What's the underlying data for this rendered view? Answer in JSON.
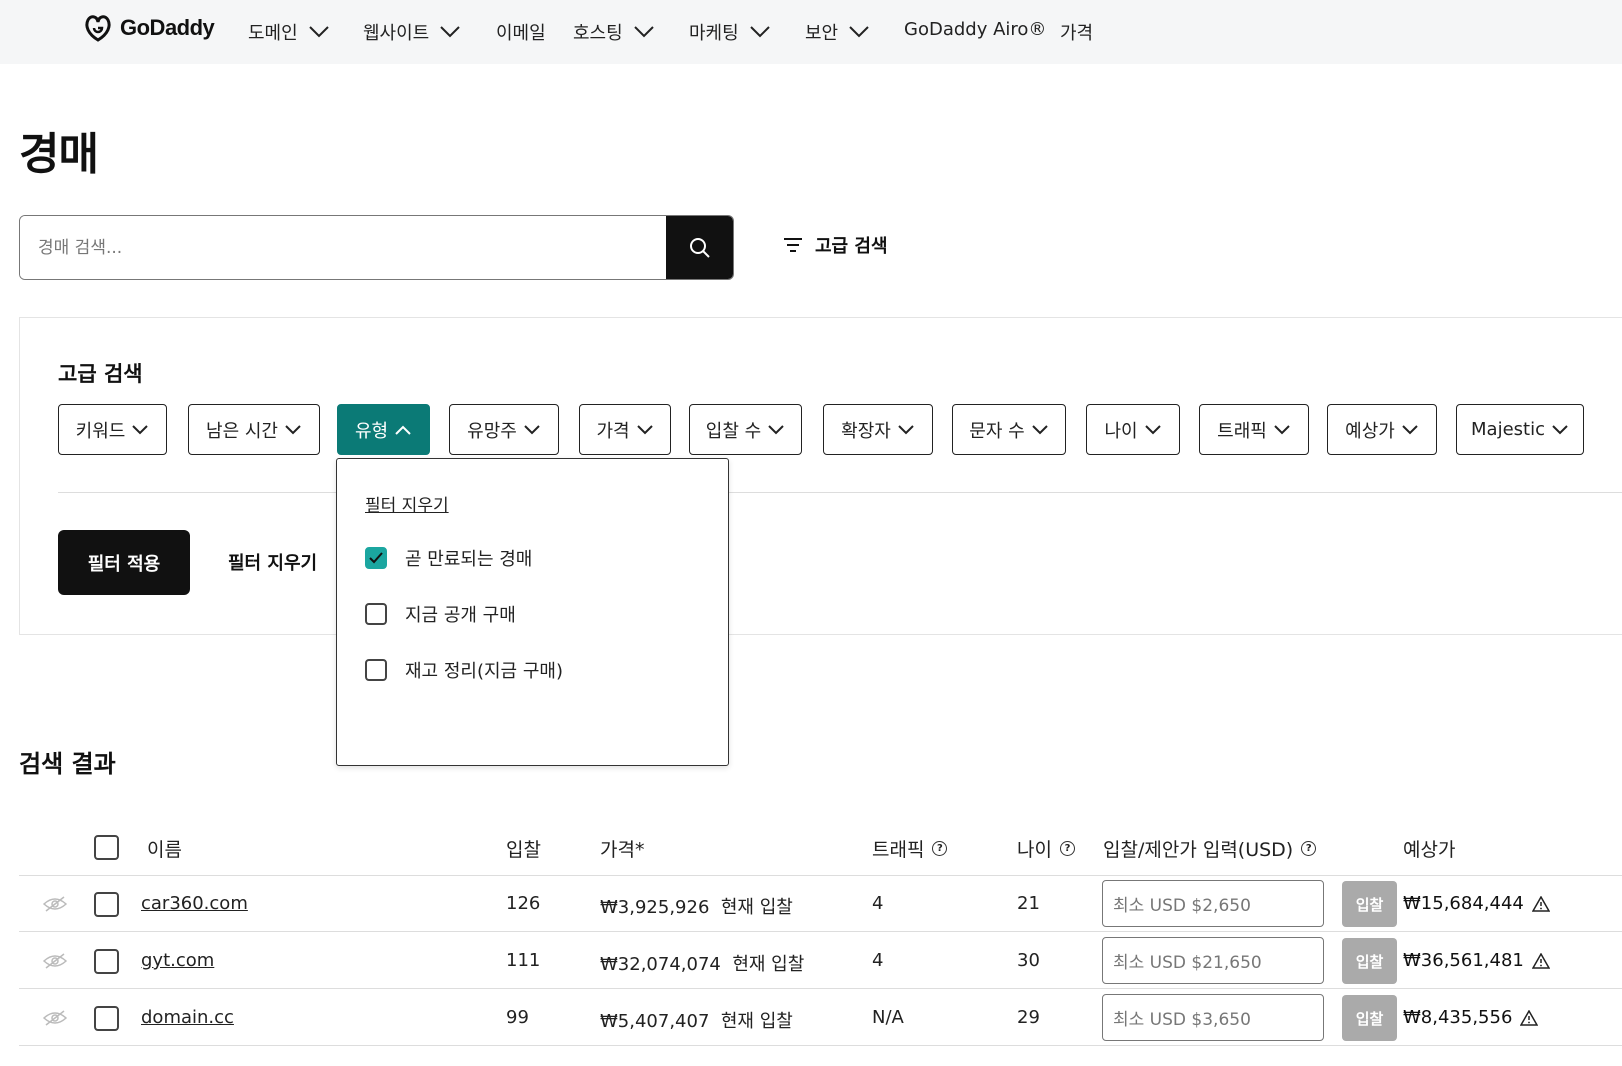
{
  "brand": {
    "name": "GoDaddy"
  },
  "nav": {
    "items": [
      {
        "label": "도메인",
        "chevron": true
      },
      {
        "label": "웹사이트",
        "chevron": true
      },
      {
        "label": "이메일",
        "chevron": false
      },
      {
        "label": "호스팅",
        "chevron": true
      },
      {
        "label": "마케팅",
        "chevron": true
      },
      {
        "label": "보안",
        "chevron": true
      },
      {
        "label": "GoDaddy Airo®",
        "chevron": false
      },
      {
        "label": "가격",
        "chevron": false
      }
    ]
  },
  "page": {
    "title": "경매"
  },
  "search": {
    "placeholder": "경매 검색...",
    "value": "",
    "advanced_label": "고급 검색"
  },
  "advanced": {
    "title": "고급 검색",
    "chips": [
      {
        "label": "키워드",
        "active": false
      },
      {
        "label": "남은 시간",
        "active": false
      },
      {
        "label": "유형",
        "active": true
      },
      {
        "label": "유망주",
        "active": false
      },
      {
        "label": "가격",
        "active": false
      },
      {
        "label": "입찰 수",
        "active": false
      },
      {
        "label": "확장자",
        "active": false
      },
      {
        "label": "문자 수",
        "active": false
      },
      {
        "label": "나이",
        "active": false
      },
      {
        "label": "트래픽",
        "active": false
      },
      {
        "label": "예상가",
        "active": false
      },
      {
        "label": "Majestic",
        "active": false
      }
    ],
    "apply_label": "필터 적용",
    "clear_label": "필터 지우기"
  },
  "type_dropdown": {
    "clear_label": "필터 지우기",
    "options": [
      {
        "label": "곧 만료되는 경매",
        "checked": true
      },
      {
        "label": "지금 공개 구매",
        "checked": false
      },
      {
        "label": "재고 정리(지금 구매)",
        "checked": false
      }
    ]
  },
  "results": {
    "title": "검색 결과",
    "columns": {
      "name": "이름",
      "bids": "입찰",
      "price": "가격*",
      "traffic": "트래픽",
      "age": "나이",
      "bid_input": "입찰/제안가 입력(USD)",
      "estimate": "예상가"
    },
    "rows": [
      {
        "domain": "car360.com",
        "bids": "126",
        "price": "₩3,925,926",
        "price_note": "현재 입찰",
        "traffic": "4",
        "age": "21",
        "bid_placeholder": "최소 USD $2,650",
        "bid_label": "입찰",
        "estimate": "₩15,684,444"
      },
      {
        "domain": "gyt.com",
        "bids": "111",
        "price": "₩32,074,074",
        "price_note": "현재 입찰",
        "traffic": "4",
        "age": "30",
        "bid_placeholder": "최소 USD $21,650",
        "bid_label": "입찰",
        "estimate": "₩36,561,481"
      },
      {
        "domain": "domain.cc",
        "bids": "99",
        "price": "₩5,407,407",
        "price_note": "현재 입찰",
        "traffic": "N/A",
        "age": "29",
        "bid_placeholder": "최소 USD $3,650",
        "bid_label": "입찰",
        "estimate": "₩8,435,556"
      }
    ]
  },
  "colors": {
    "accent": "#0b7a76",
    "checkbox_checked": "#1ba6a0",
    "primary_button": "#111111",
    "bid_button": "#aaaaaa"
  }
}
